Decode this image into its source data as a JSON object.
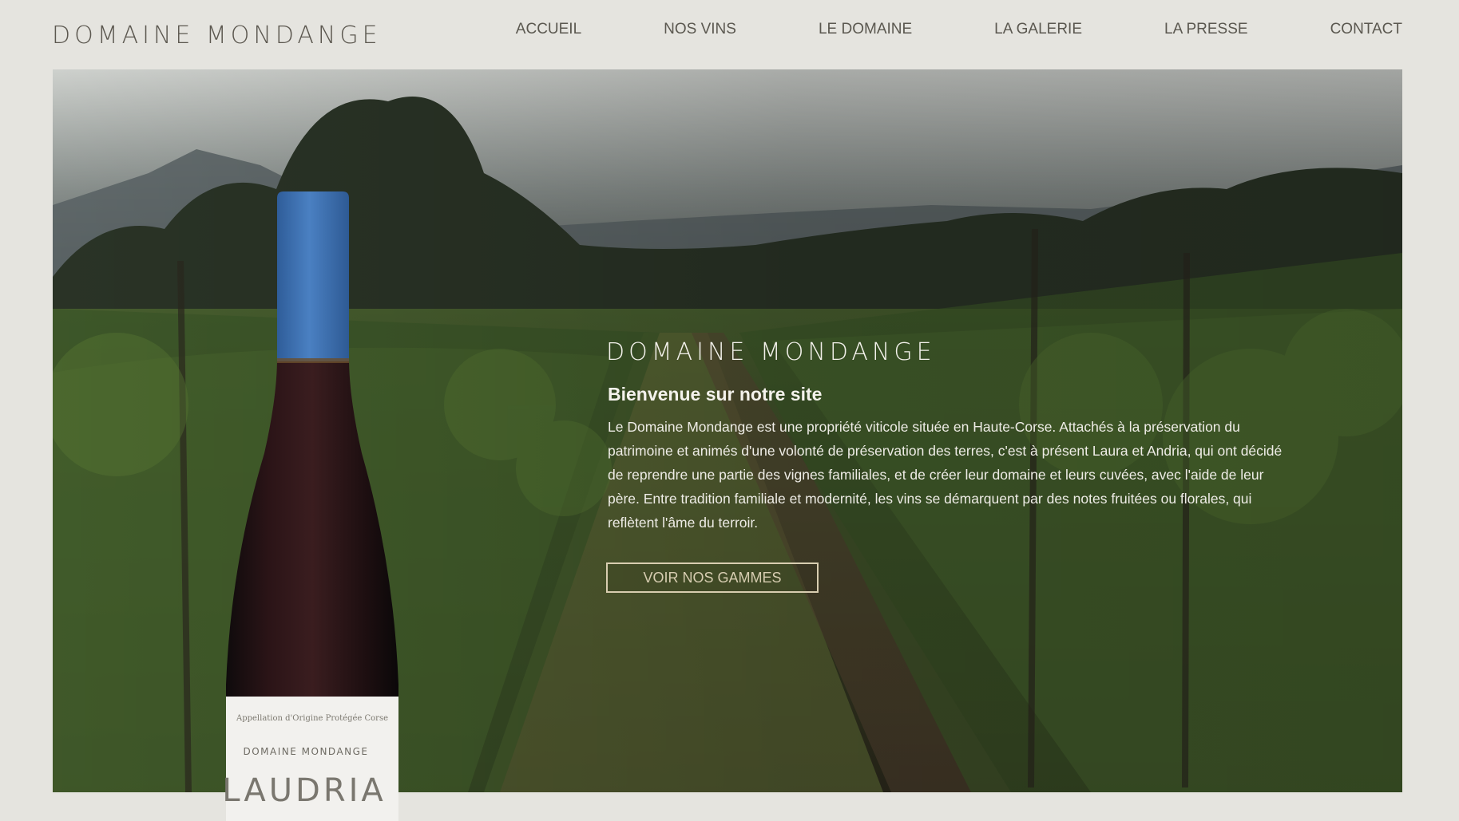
{
  "header": {
    "brand": "DOMAINE MONDANGE",
    "nav": [
      "ACCUEIL",
      "NOS VINS",
      "LE DOMAINE",
      "LA GALERIE",
      "LA PRESSE",
      "CONTACT"
    ]
  },
  "hero": {
    "title": "DOMAINE MONDANGE",
    "subtitle": "Bienvenue sur notre site",
    "text": "Le Domaine Mondange est une propriété viticole située en Haute-Corse. Attachés à la préservation du patrimoine et animés d'une volonté de préservation des terres, c'est à présent Laura et Andria, qui ont décidé de reprendre une partie des vignes familiales, et de créer leur domaine et leurs cuvées, avec l'aide de leur père. Entre tradition familiale et modernité, les vins se démarquent par des notes fruitées ou florales, qui reflètent l'âme du terroir.",
    "cta": "VOIR NOS GAMMES"
  },
  "bottle": {
    "appellation": "Appellation d'Origine Protégée Corse",
    "domain": "DOMAINE MONDANGE",
    "name": "LAUDRIA",
    "capsule_color": "#3f73b6"
  },
  "colors": {
    "background": "#e5e4df",
    "text": "#5b5850",
    "button_border": "#d8cdb0"
  }
}
